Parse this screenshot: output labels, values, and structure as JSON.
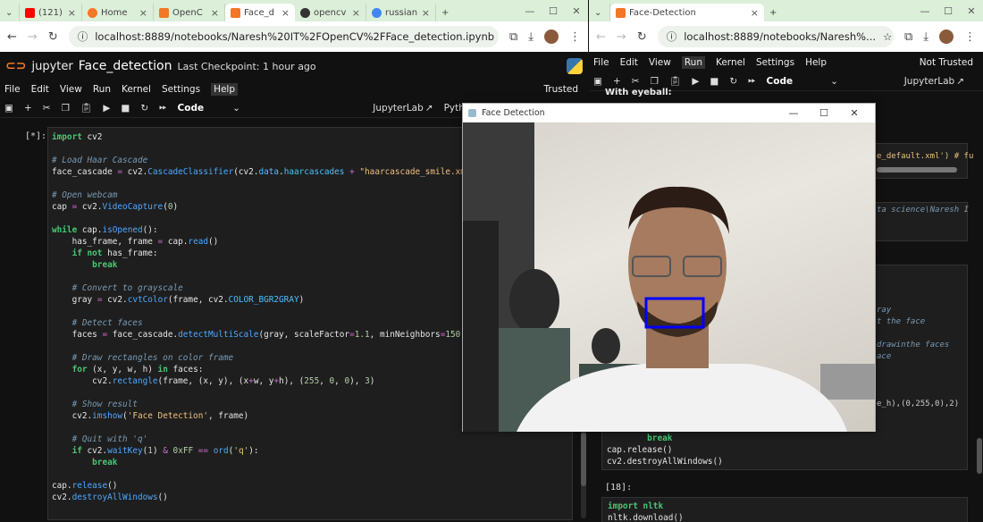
{
  "left_browser": {
    "tabs": [
      {
        "label": "(121) ",
        "icon": "youtube-icon",
        "color": "#ff0000"
      },
      {
        "label": "Home",
        "icon": "jupyter-icon",
        "color": "#f37726"
      },
      {
        "label": "OpenC",
        "icon": "jupyter-icon",
        "color": "#f37726"
      },
      {
        "label": "Face_d",
        "icon": "jupyter-icon",
        "color": "#f37726",
        "active": true
      },
      {
        "label": "opencv",
        "icon": "github-icon",
        "color": "#333333"
      },
      {
        "label": "russian",
        "icon": "google-icon",
        "color": "#4285f4"
      }
    ],
    "url": "localhost:8889/notebooks/Naresh%20IT%2FOpenCV%2FFace_detection.ipynb",
    "notebook": {
      "logo": "jupyter",
      "title": "Face_detection",
      "checkpoint": "Last Checkpoint: 1 hour ago",
      "menu": [
        "File",
        "Edit",
        "View",
        "Run",
        "Kernel",
        "Settings",
        "Help"
      ],
      "trusted": "Trusted",
      "toolbar_cell_type": "Code",
      "jupyterlab": "JupyterLab",
      "kernel": "Python",
      "cell_prompt": "[*]:"
    }
  },
  "right_browser": {
    "tab": "Face-Detection",
    "url": "localhost:8889/notebooks/Naresh%...",
    "menu": [
      "File",
      "Edit",
      "View",
      "Run",
      "Kernel",
      "Settings",
      "Help"
    ],
    "not_trusted": "Not Trusted",
    "toolbar_cell_type": "Code",
    "jupyterlab": "JupyterLab",
    "heading_fragment": "With eyeball:",
    "fragments": {
      "f1": "e_default.xml') # fu",
      "f2": "ta science\\Naresh I",
      "f3": "ray",
      "f4": "t the face",
      "f5": "drawinthe faces",
      "f6": "ace",
      "f7": "e_h),(0,255,0),2)"
    },
    "cell_tail": [
      "        break",
      "cap.release()",
      "cv2.destroyAllWindows()"
    ],
    "next_prompt": "[18]:",
    "next_code": [
      "import nltk",
      "nltk.download()"
    ]
  },
  "popup": {
    "title": "Face Detection",
    "detection_box_color": "#0000ff"
  }
}
